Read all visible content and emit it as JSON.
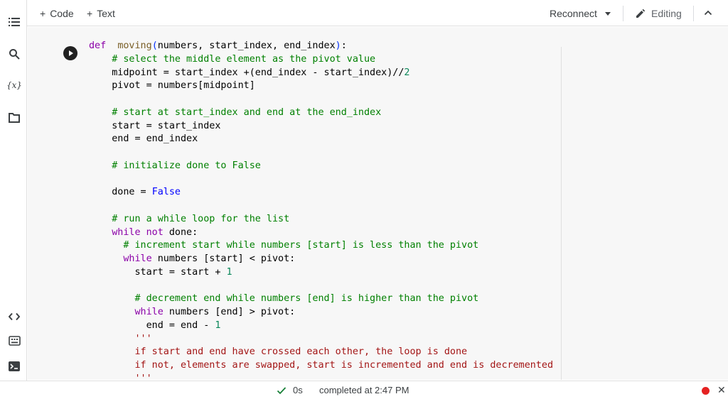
{
  "toolbar": {
    "add_code": "Code",
    "add_text": "Text",
    "reconnect": "Reconnect",
    "editing": "Editing",
    "plus_glyph": "+"
  },
  "sidebar": {
    "variables_label": "{x}",
    "icons": [
      "table-of-contents-icon",
      "search-icon",
      "variables-icon",
      "files-icon",
      "code-snippets-icon",
      "command-palette-icon",
      "terminal-icon"
    ]
  },
  "cell": {
    "lines": [
      [
        [
          "kw",
          "def"
        ],
        [
          "",
          "  "
        ],
        [
          "fn",
          "moving"
        ],
        [
          "par",
          "("
        ],
        [
          "",
          "numbers, start_index, end_index"
        ],
        [
          "par",
          ")"
        ],
        [
          "",
          ":"
        ]
      ],
      [
        [
          "",
          "    "
        ],
        [
          "cm",
          "# select the middle element as the pivot value"
        ]
      ],
      [
        [
          "",
          "    midpoint = start_index +(end_index - start_index)//"
        ],
        [
          "num",
          "2"
        ]
      ],
      [
        [
          "",
          "    pivot = numbers[midpoint]"
        ]
      ],
      [
        [
          "",
          ""
        ]
      ],
      [
        [
          "",
          "    "
        ],
        [
          "cm",
          "# start at start_index and end at the end_index"
        ]
      ],
      [
        [
          "",
          "    start = start_index"
        ]
      ],
      [
        [
          "",
          "    end = end_index"
        ]
      ],
      [
        [
          "",
          ""
        ]
      ],
      [
        [
          "",
          "    "
        ],
        [
          "cm",
          "# initialize done to False"
        ]
      ],
      [
        [
          "",
          ""
        ]
      ],
      [
        [
          "",
          "    done = "
        ],
        [
          "bool",
          "False"
        ]
      ],
      [
        [
          "",
          ""
        ]
      ],
      [
        [
          "",
          "    "
        ],
        [
          "cm",
          "# run a while loop for the list"
        ]
      ],
      [
        [
          "",
          "    "
        ],
        [
          "kw",
          "while"
        ],
        [
          "",
          " "
        ],
        [
          "kw",
          "not"
        ],
        [
          "",
          " done:"
        ]
      ],
      [
        [
          "",
          "      "
        ],
        [
          "cm",
          "# increment start while numbers [start] is less than the pivot"
        ]
      ],
      [
        [
          "",
          "      "
        ],
        [
          "kw",
          "while"
        ],
        [
          "",
          " numbers [start] < pivot:"
        ]
      ],
      [
        [
          "",
          "        start = start + "
        ],
        [
          "num",
          "1"
        ]
      ],
      [
        [
          "",
          ""
        ]
      ],
      [
        [
          "",
          "        "
        ],
        [
          "cm",
          "# decrement end while numbers [end] is higher than the pivot"
        ]
      ],
      [
        [
          "",
          "        "
        ],
        [
          "kw",
          "while"
        ],
        [
          "",
          " numbers [end] > pivot:"
        ]
      ],
      [
        [
          "",
          "          end = end - "
        ],
        [
          "num",
          "1"
        ]
      ],
      [
        [
          "",
          "        "
        ],
        [
          "str",
          "'''"
        ]
      ],
      [
        [
          "",
          "        "
        ],
        [
          "str",
          "if start and end have crossed each other, the loop is done"
        ]
      ],
      [
        [
          "",
          "        "
        ],
        [
          "str",
          "if not, elements are swapped, start is incremented and end is decremented"
        ]
      ],
      [
        [
          "",
          "        "
        ],
        [
          "str",
          "'''"
        ]
      ]
    ]
  },
  "status": {
    "seconds": "0s",
    "completed": "completed at 2:47 PM",
    "close_glyph": "✕"
  },
  "colors": {
    "keyword": "#8b00a8",
    "function": "#795e26",
    "comment": "#008000",
    "number": "#098658",
    "bool": "#0000ff",
    "string": "#a31515",
    "status_dot": "#e52222",
    "check": "#188038"
  }
}
